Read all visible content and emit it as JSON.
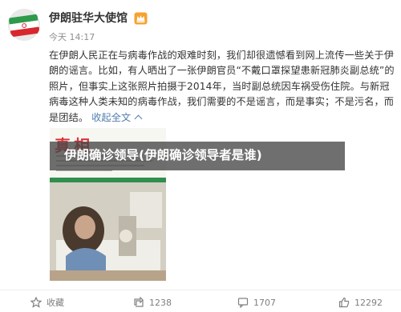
{
  "post": {
    "author": "伊朗驻华大使馆",
    "time": "今天 14:17",
    "text": "在伊朗人民正在与病毒作战的艰难时刻，我们却很遗憾看到网上流传一些关于伊朗的谣言。比如，有人晒出了一张伊朗官员“不戴口罩探望患新冠肺炎副总统”的照片，但事实上这张照片拍摄于2014年，当时副总统因车祸受伤住院。与新冠病毒这种人类未知的病毒作战，我们需要的不是谣言，而是事实；不是污名，而是团结。",
    "expand_label": "收起全文",
    "image_stamp_text": "真相",
    "overlay_title": "伊朗确诊领导(伊朗确诊领导者是谁)"
  },
  "actions": {
    "favorite": "收藏",
    "repost": "1238",
    "comment": "1707",
    "like": "12292"
  },
  "icons": {
    "avatar": "iran-flag-avatar",
    "badge": "crown-badge-icon",
    "favorite": "star-icon",
    "repost": "repost-icon",
    "comment": "comment-icon",
    "like": "thumb-up-icon"
  },
  "colors": {
    "link": "#507daf",
    "muted": "#808080",
    "overlay": "#464646",
    "badge": "#f7a12e"
  }
}
